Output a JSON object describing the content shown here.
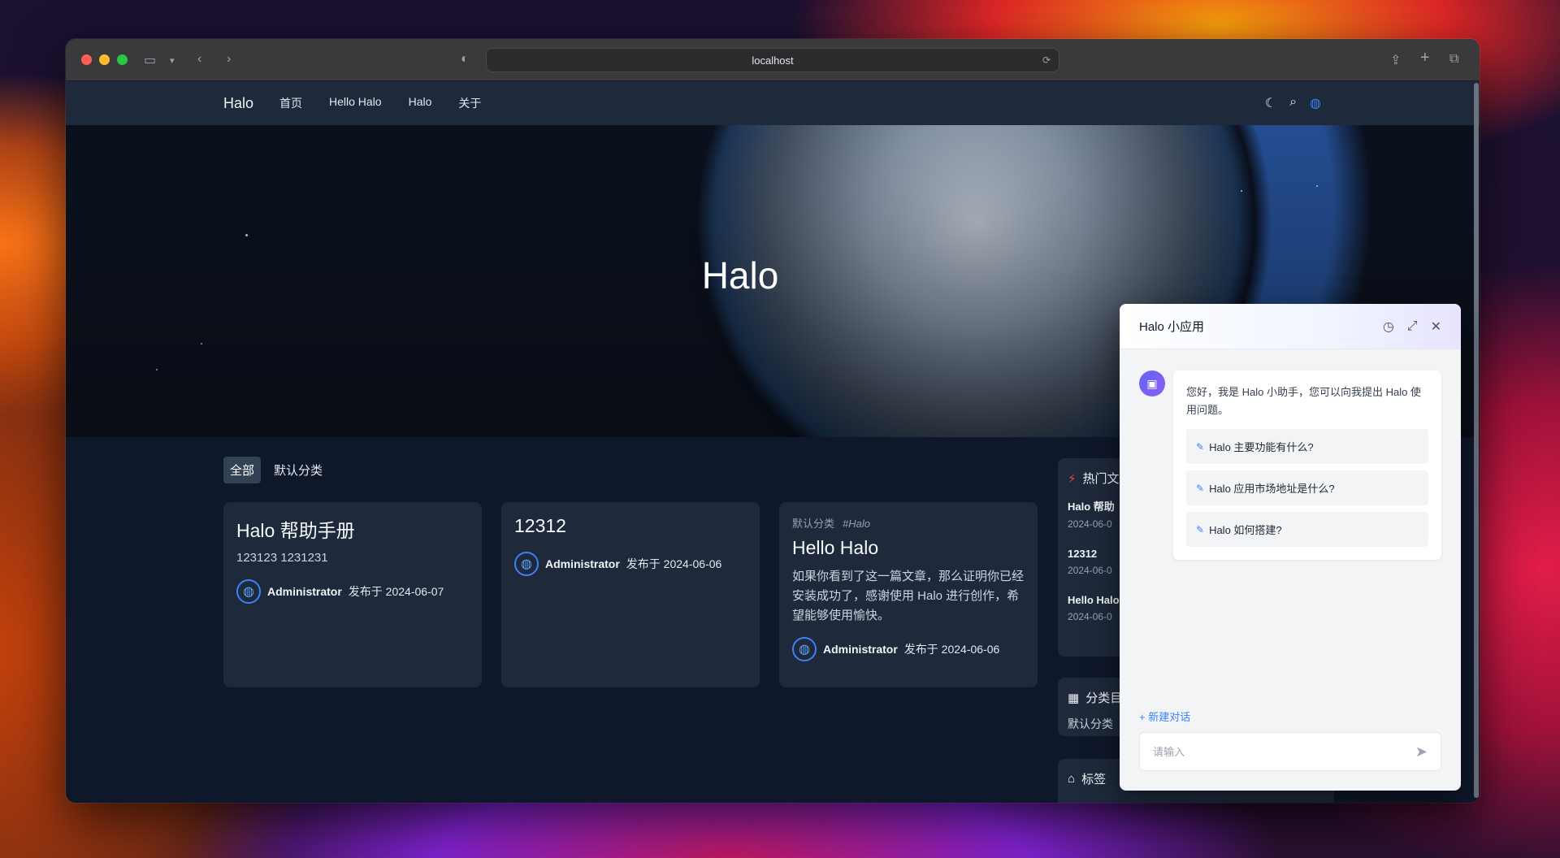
{
  "browser": {
    "url": "localhost"
  },
  "site": {
    "brand": "Halo",
    "nav": [
      "首页",
      "Hello Halo",
      "Halo",
      "关于"
    ],
    "hero_title": "Halo"
  },
  "filters": [
    "全部",
    "默认分类"
  ],
  "posts": [
    {
      "title": "Halo 帮助手册",
      "desc": "123123 1231231",
      "author": "Administrator",
      "date": "发布于 2024-06-07"
    },
    {
      "title": "12312",
      "desc": "",
      "author": "Administrator",
      "date": "发布于 2024-06-06"
    },
    {
      "category": "默认分类",
      "tag": "#Halo",
      "title": "Hello Halo",
      "excerpt": "如果你看到了这一篇文章，那么证明你已经安装成功了，感谢使用 Halo 进行创作，希望能够使用愉快。",
      "author": "Administrator",
      "date": "发布于 2024-06-06"
    }
  ],
  "sidebar": {
    "hot_title": "热门文",
    "hot_items": [
      {
        "title": "Halo 帮助",
        "date": "2024-06-0"
      },
      {
        "title": "12312",
        "date": "2024-06-0"
      },
      {
        "title": "Hello Halo",
        "date": "2024-06-0"
      }
    ],
    "cat_title": "分类目",
    "cat_item": "默认分类",
    "tag_title": "标签"
  },
  "chat": {
    "title": "Halo 小应用",
    "greeting": "您好，我是 Halo 小助手，您可以向我提出 Halo 使用问题。",
    "suggestions": [
      "Halo 主要功能有什么?",
      "Halo 应用市场地址是什么?",
      "Halo 如何搭建?"
    ],
    "new_chat": "新建对话",
    "input_placeholder": "请输入"
  }
}
